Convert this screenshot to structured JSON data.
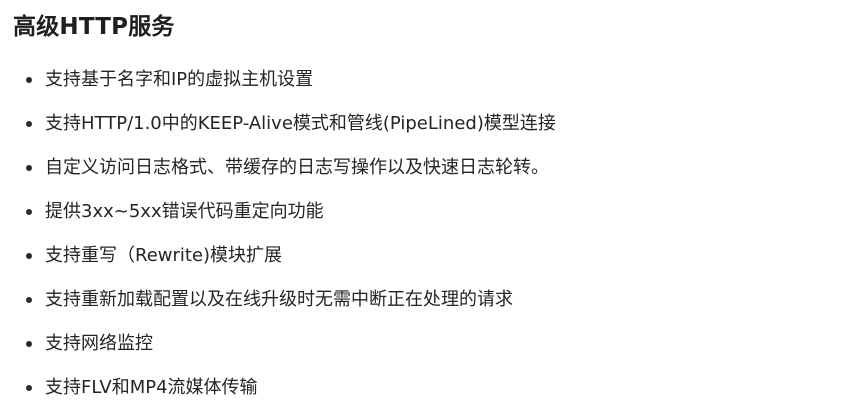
{
  "heading": "高级HTTP服务",
  "features": [
    "支持基于名字和IP的虚拟主机设置",
    "支持HTTP/1.0中的KEEP-Alive模式和管线(PipeLined)模型连接",
    "自定义访问日志格式、带缓存的日志写操作以及快速日志轮转。",
    "提供3xx~5xx错误代码重定向功能",
    "支持重写（Rewrite)模块扩展",
    "支持重新加载配置以及在线升级时无需中断正在处理的请求",
    "支持网络监控",
    "支持FLV和MP4流媒体传输"
  ]
}
